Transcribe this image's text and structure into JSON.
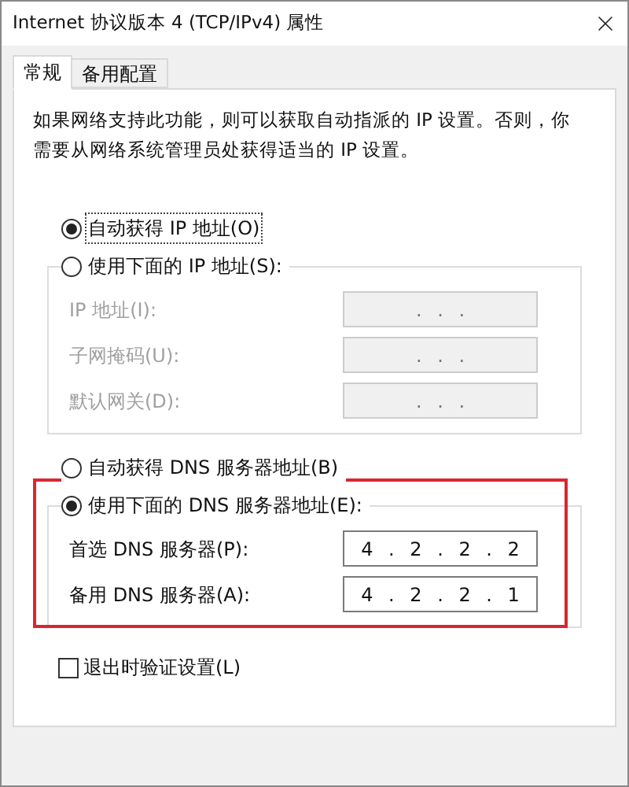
{
  "window": {
    "title": "Internet 协议版本 4 (TCP/IPv4) 属性"
  },
  "tabs": [
    {
      "label": "常规",
      "selected": true
    },
    {
      "label": "备用配置",
      "selected": false
    }
  ],
  "description": "如果网络支持此功能，则可以获取自动指派的 IP 设置。否则，你需要从网络系统管理员处获得适当的 IP 设置。",
  "ip_section": {
    "options": [
      {
        "label": "自动获得 IP 地址(O)",
        "selected": true
      },
      {
        "label": "使用下面的 IP 地址(S):",
        "selected": false
      }
    ],
    "fields": [
      {
        "label": "IP 地址(I):",
        "value": ". . .",
        "disabled": true
      },
      {
        "label": "子网掩码(U):",
        "value": ". . .",
        "disabled": true
      },
      {
        "label": "默认网关(D):",
        "value": ". . .",
        "disabled": true
      }
    ]
  },
  "dns_section": {
    "options": [
      {
        "label": "自动获得 DNS 服务器地址(B)",
        "selected": false
      },
      {
        "label": "使用下面的 DNS 服务器地址(E):",
        "selected": true
      }
    ],
    "fields": [
      {
        "label": "首选 DNS 服务器(P):",
        "value": "4 . 2 . 2 . 2",
        "disabled": false
      },
      {
        "label": "备用 DNS 服务器(A):",
        "value": "4 . 2 . 2 . 1",
        "disabled": false
      }
    ]
  },
  "validate_checkbox": {
    "label": "退出时验证设置(L)",
    "checked": false
  }
}
